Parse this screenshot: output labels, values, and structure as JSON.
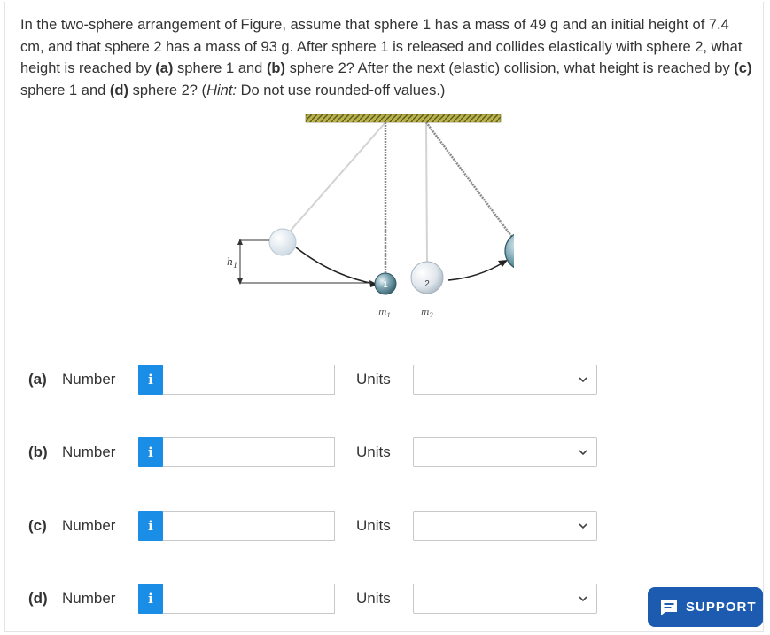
{
  "question": {
    "s1": "In the two-sphere arrangement of Figure, assume that sphere 1 has a mass of 49 g and an initial height of 7.4 cm, and that sphere 2 has a mass of 93 g. After sphere 1 is released and collides elastically with sphere 2, what height is reached by ",
    "a": "(a)",
    "s2": " sphere 1 and ",
    "b": "(b)",
    "s3": " sphere 2? After the next (elastic) collision, what height is reached by ",
    "c": "(c)",
    "s4": " sphere 1 and ",
    "d": "(d)",
    "s5": " sphere 2? (",
    "hint": "Hint:",
    "s6": " Do not use rounded-off values.)"
  },
  "figure": {
    "h_label": "h",
    "h_sub": "1",
    "sphere1_label": "1",
    "sphere2_label": "2",
    "m1_label": "m",
    "m1_sub": "1",
    "m2_label": "m",
    "m2_sub": "2"
  },
  "rows": [
    {
      "part": "(a)",
      "number_label": "Number",
      "info_icon": "i",
      "value": "",
      "units_label": "Units",
      "units_selected": ""
    },
    {
      "part": "(b)",
      "number_label": "Number",
      "info_icon": "i",
      "value": "",
      "units_label": "Units",
      "units_selected": ""
    },
    {
      "part": "(c)",
      "number_label": "Number",
      "info_icon": "i",
      "value": "",
      "units_label": "Units",
      "units_selected": ""
    },
    {
      "part": "(d)",
      "number_label": "Number",
      "info_icon": "i",
      "value": "",
      "units_label": "Units",
      "units_selected": ""
    }
  ],
  "support": {
    "label": "SUPPORT",
    "icon": "chat-icon"
  },
  "colors": {
    "info_blue": "#1a8ee6",
    "support_blue": "#1d5bb0"
  }
}
